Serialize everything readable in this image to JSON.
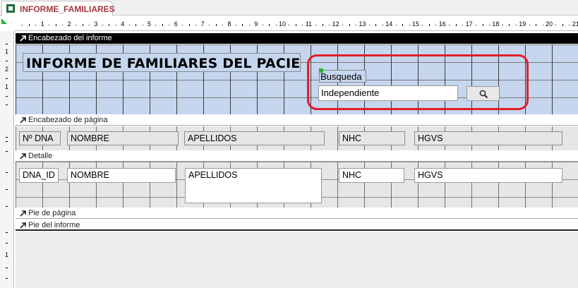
{
  "tab": {
    "label": "INFORME_FAMILIARES"
  },
  "ruler": {
    "numbers": [
      "1",
      "2",
      "3",
      "4",
      "5",
      "6",
      "7",
      "8",
      "9",
      "10",
      "11",
      "12",
      "13",
      "14",
      "15",
      "16",
      "17",
      "18",
      "19",
      "20",
      "21"
    ]
  },
  "vruler": {
    "numbers": [
      "1",
      "2",
      "1",
      "1"
    ]
  },
  "sections": {
    "report_header": "Encabezado del informe",
    "page_header": "Encabezado de página",
    "detail": "Detalle",
    "page_footer": "Pie de página",
    "report_footer": "Pie del informe"
  },
  "report_header": {
    "title": "INFORME DE FAMILIARES DEL PACIENTE",
    "search_label": "Busqueda",
    "search_value": "Independiente"
  },
  "page_header": {
    "labels": [
      "Nº DNA",
      "NOMBRE",
      "APELLIDOS",
      "NHC",
      "HGVS"
    ]
  },
  "detail": {
    "fields": [
      "DNA_ID",
      "NOMBRE",
      "APELLIDOS",
      "NHC",
      "HGVS"
    ]
  },
  "colors": {
    "header_bg": "#c5d6ee",
    "highlight_ring": "#e01e2a",
    "tab_text": "#a4373a"
  },
  "icons": {
    "tab": "report-icon",
    "search_button": "magnifier-icon",
    "section": "section-arrow-icon"
  }
}
